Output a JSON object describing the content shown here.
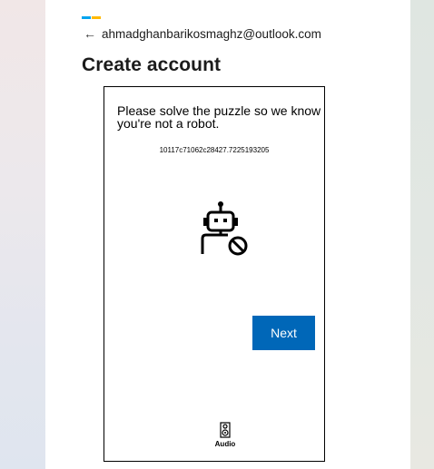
{
  "header": {
    "back_arrow": "←",
    "email": "ahmadghanbarikosmaghz@outlook.com",
    "title": "Create account",
    "logo_colors": [
      "#00a4ef",
      "#ffb900"
    ]
  },
  "puzzle": {
    "prompt": "Please solve the puzzle so we know you're not a robot.",
    "id": "10117c71062c28427.7225193205",
    "illustration_icon": "robot-blocked-icon",
    "next_label": "Next",
    "next_color": "#0067b8",
    "audio_icon": "speaker-icon",
    "audio_label": "Audio"
  }
}
